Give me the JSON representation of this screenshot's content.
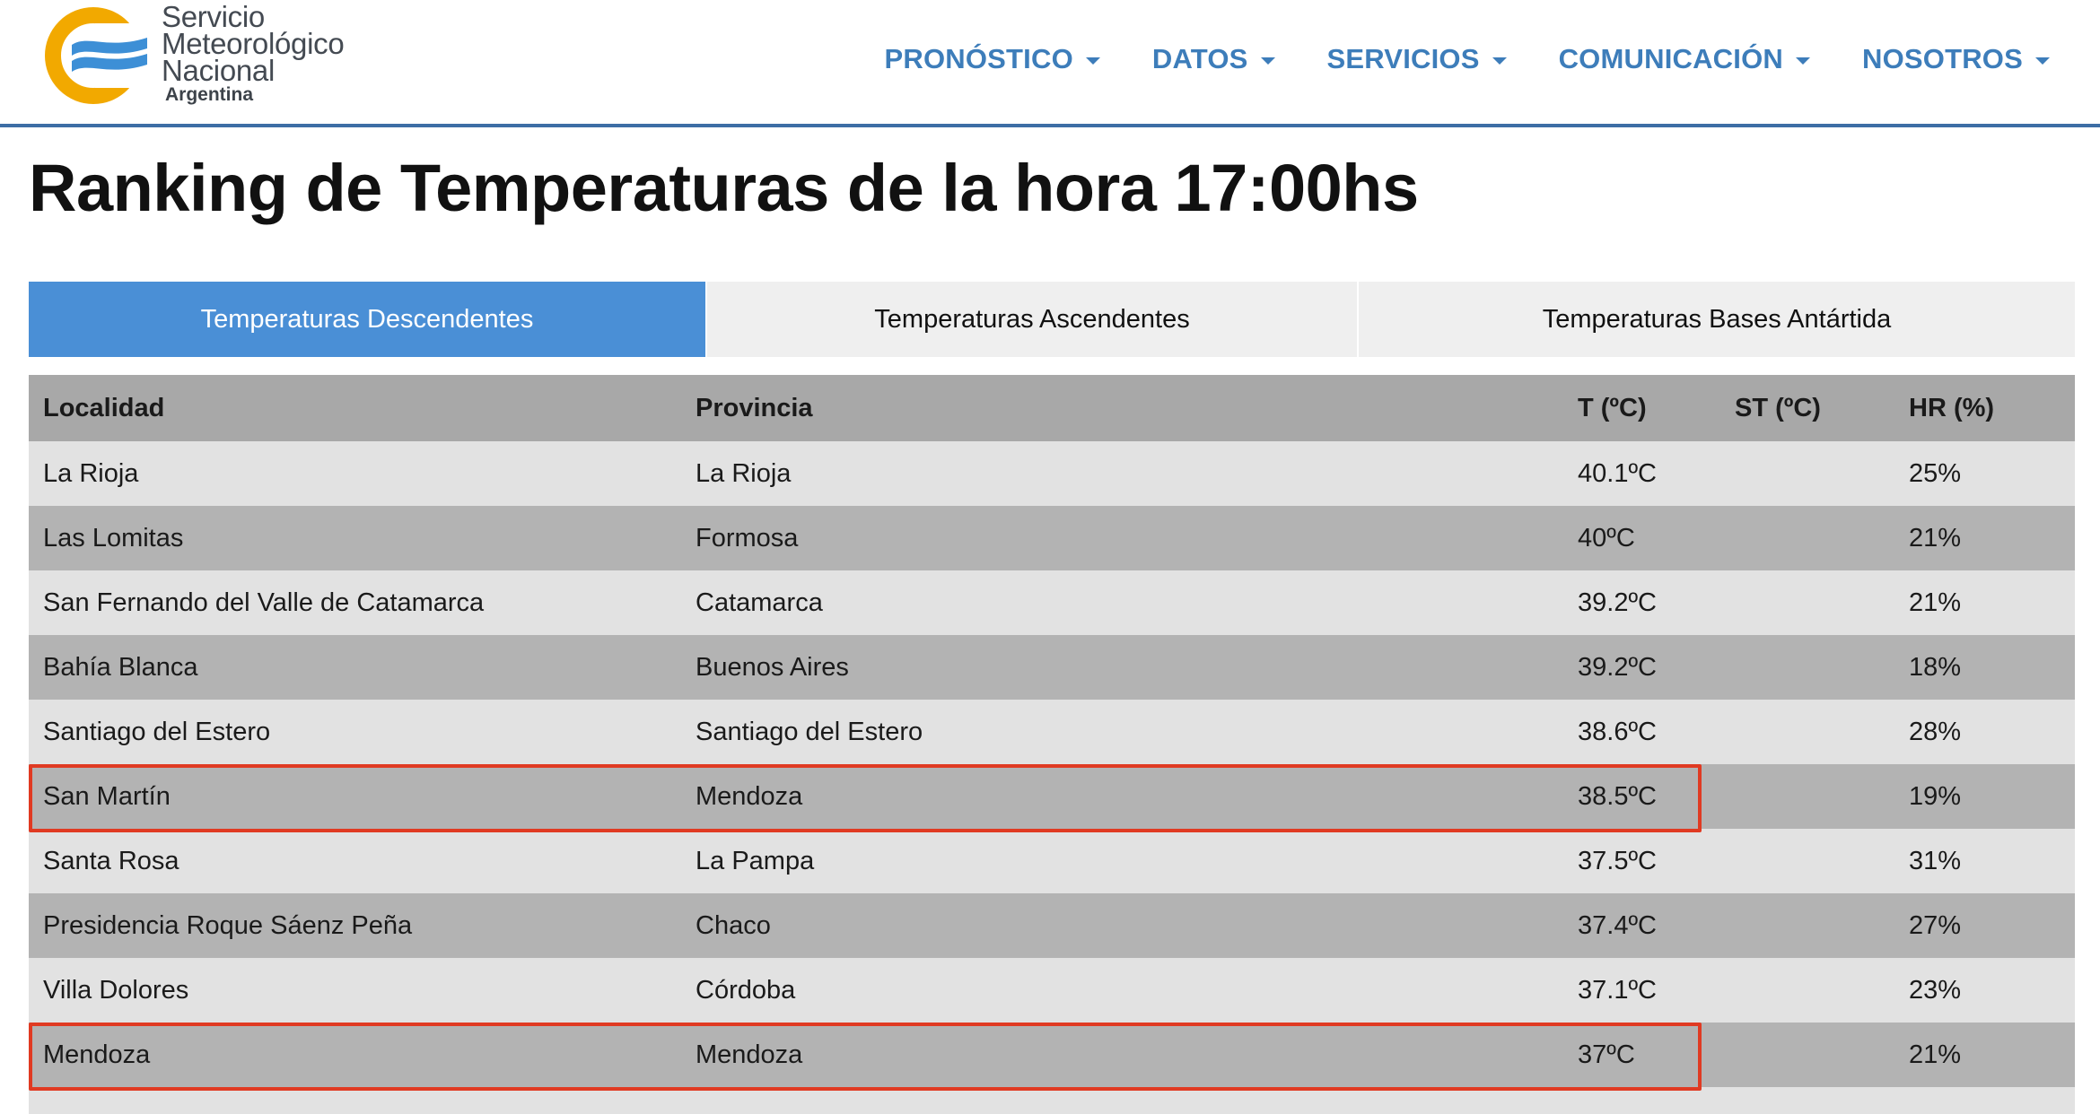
{
  "logo": {
    "line1": "Servicio",
    "line2": "Meteorológico",
    "line3": "Nacional",
    "sub": "Argentina",
    "colors": {
      "ring": "#f2a900",
      "waves": "#3d8fd6"
    }
  },
  "nav": [
    {
      "label": "PRONÓSTICO"
    },
    {
      "label": "DATOS"
    },
    {
      "label": "SERVICIOS"
    },
    {
      "label": "COMUNICACIÓN"
    },
    {
      "label": "NOSOTROS"
    }
  ],
  "page": {
    "title": "Ranking de Temperaturas de la hora 17:00hs"
  },
  "tabs": [
    {
      "label": "Temperaturas Descendentes",
      "active": true
    },
    {
      "label": "Temperaturas Ascendentes",
      "active": false
    },
    {
      "label": "Temperaturas Bases Antártida",
      "active": false
    }
  ],
  "table": {
    "headers": {
      "localidad": "Localidad",
      "provincia": "Provincia",
      "t": "T (ºC)",
      "st": "ST (ºC)",
      "hr": "HR (%)"
    },
    "rows": [
      {
        "localidad": "La Rioja",
        "provincia": "La Rioja",
        "t": "40.1ºC",
        "st": "",
        "hr": "25%"
      },
      {
        "localidad": "Las Lomitas",
        "provincia": "Formosa",
        "t": "40ºC",
        "st": "",
        "hr": "21%"
      },
      {
        "localidad": "San Fernando del Valle de Catamarca",
        "provincia": "Catamarca",
        "t": "39.2ºC",
        "st": "",
        "hr": "21%"
      },
      {
        "localidad": "Bahía Blanca",
        "provincia": "Buenos Aires",
        "t": "39.2ºC",
        "st": "",
        "hr": "18%"
      },
      {
        "localidad": "Santiago del Estero",
        "provincia": "Santiago del Estero",
        "t": "38.6ºC",
        "st": "",
        "hr": "28%"
      },
      {
        "localidad": "San Martín",
        "provincia": "Mendoza",
        "t": "38.5ºC",
        "st": "",
        "hr": "19%"
      },
      {
        "localidad": "Santa Rosa",
        "provincia": "La Pampa",
        "t": "37.5ºC",
        "st": "",
        "hr": "31%"
      },
      {
        "localidad": "Presidencia Roque Sáenz Peña",
        "provincia": "Chaco",
        "t": "37.4ºC",
        "st": "",
        "hr": "27%"
      },
      {
        "localidad": "Villa Dolores",
        "provincia": "Córdoba",
        "t": "37.1ºC",
        "st": "",
        "hr": "23%"
      },
      {
        "localidad": "Mendoza",
        "provincia": "Mendoza",
        "t": "37ºC",
        "st": "",
        "hr": "21%"
      }
    ]
  },
  "annotation_color": "#e03a22"
}
